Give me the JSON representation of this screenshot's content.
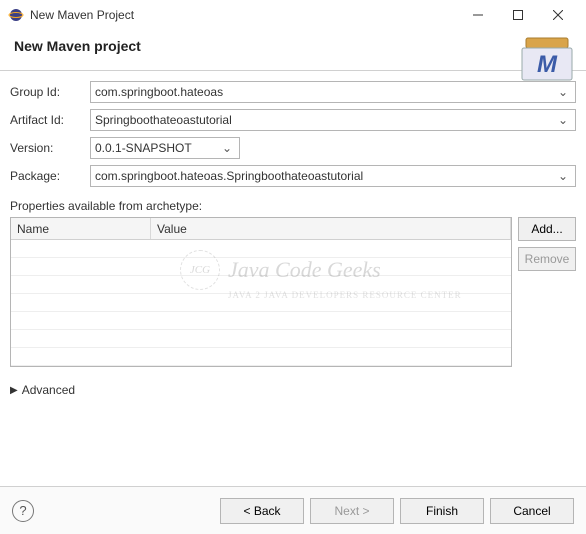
{
  "window": {
    "title": "New Maven Project",
    "minimize_icon": "minimize",
    "maximize_icon": "maximize",
    "close_icon": "close"
  },
  "header": {
    "page_title": "New Maven project"
  },
  "form": {
    "group_id": {
      "label": "Group Id:",
      "value": "com.springboot.hateoas"
    },
    "artifact_id": {
      "label": "Artifact Id:",
      "value": "Springboothateoastutorial"
    },
    "version": {
      "label": "Version:",
      "value": "0.0.1-SNAPSHOT"
    },
    "package": {
      "label": "Package:",
      "value": "com.springboot.hateoas.Springboothateoastutorial"
    }
  },
  "properties": {
    "section_label": "Properties available from archetype:",
    "columns": {
      "name": "Name",
      "value": "Value"
    },
    "rows": [],
    "buttons": {
      "add": "Add...",
      "remove": "Remove"
    }
  },
  "advanced": {
    "label": "Advanced"
  },
  "footer": {
    "back": "< Back",
    "next": "Next >",
    "finish": "Finish",
    "cancel": "Cancel"
  },
  "watermark": {
    "badge": "JCG",
    "line1": "Java Code Geeks",
    "line2": "JAVA 2 JAVA DEVELOPERS RESOURCE CENTER"
  }
}
